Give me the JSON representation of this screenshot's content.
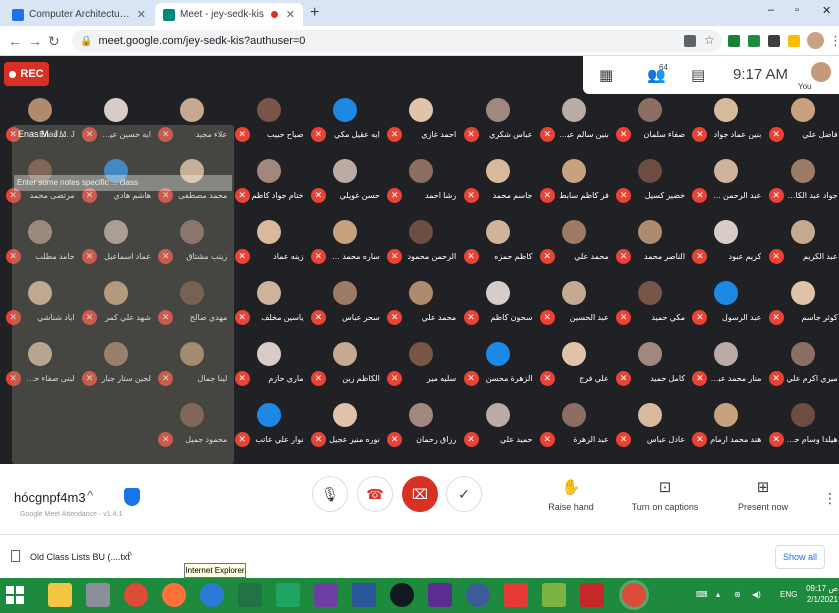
{
  "browser": {
    "tabs": [
      {
        "title": "Computer Architecture Computer",
        "color": "#1a73e8",
        "active": false
      },
      {
        "title": "Meet - jey-sedk-kis",
        "color": "#00897b",
        "active": true
      }
    ],
    "new_tab": "+",
    "url": "meet.google.com/jey-sedk-kis?authuser=0",
    "window_min": "–",
    "window_restore": "▫",
    "window_close": "✕"
  },
  "meet": {
    "rec_label": "REC",
    "participants_count": "64",
    "time": "9:17 AM",
    "you_label": "You",
    "meeting_code": "hócgnpf4m3",
    "ext_footer": "Google Meet Attendance - v1.4.1",
    "overlay_header": "Enas M. J...",
    "overlay_input": "Enter some notes specific ... class",
    "raise_hand": "Raise hand",
    "captions": "Turn on captions",
    "present": "Present now",
    "participants": [
      "فاضل علي",
      "بنين عماد جواد",
      "صفاء سلمان",
      "بنين سالم عباس",
      "عباس شكري",
      "احمد غازي",
      "ايه عقيل مكي",
      "صباح حبيب",
      "علاء مجيد",
      "ايه حسين عيسى",
      "Enas M. J...",
      "جواد عبد الكاظم",
      "عبد الرحمن حرز",
      "خضير كسيل",
      "فر كاظم سابط",
      "جاسم محمد",
      "رشا احمد",
      "حسن غويلي",
      "ختام جواد كاظم",
      "محمد مصطفى",
      "هاشم هادي",
      "مرتضى محمد",
      "عبد الكريم",
      "كريم عبود",
      "الناصر محمد",
      "محمد علي",
      "كاظم حمزه",
      "الرحمن محمود",
      "ساره محمد علي",
      "زينه عماد",
      "زينب مشتاق",
      "عماد اسماعيل",
      "حامد مطلب",
      "كوثر جاسم",
      "عبد الرسول",
      "مكي حميد",
      "عبد الحسين",
      "سحون كاظم",
      "محمد علي",
      "سحر عباس",
      "ياسين مخلف",
      "مهدي صالح",
      "شهد علي كمر",
      "اياد شناشي",
      "ميري اكرم علي",
      "منار محمد عبدالله",
      "كامل حميد",
      "علي فرج",
      "الزهرة محسن",
      "سليه مير",
      "الكاظم زين",
      "ماري حازم",
      "لينا جمال",
      "لجين ستار جبار",
      "لبنى صفاء حسن",
      "هيلدا وسام حبيب",
      "هند محمد ارمام",
      "عادل عباس",
      "عبد الزهرة",
      "حميد علي",
      "رزاق رحمان",
      "نوره منير عجيل",
      "نوار علي عاتب",
      "محمود جميل"
    ],
    "avatar_colors": [
      "#c8a27e",
      "#d9b99b",
      "#8d6e63",
      "#bcaaa4",
      "#a1887f",
      "#e0c3a8",
      "#1e88e5",
      "#795548",
      "#c5a990",
      "#d7ccc8",
      "#b08a6c",
      "#9e7b65",
      "#cfb39b",
      "#6d4c41"
    ]
  },
  "downloads": {
    "file": "Old Class Lists BU (....txt",
    "show_all": "Show all",
    "tooltip": "Internet Explorer"
  },
  "taskbar": {
    "time": "09:17",
    "date": "2/1/2021",
    "lang": "ENG",
    "lang_day": "ص"
  }
}
